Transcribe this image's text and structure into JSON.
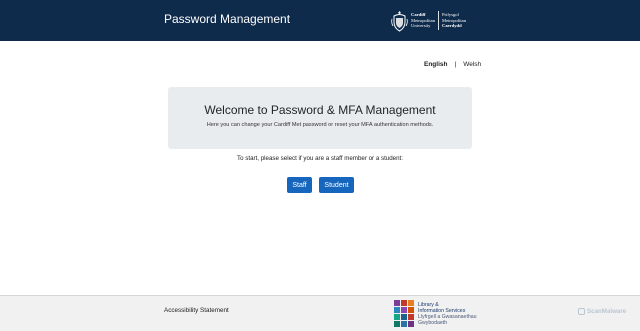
{
  "header": {
    "title": "Password Management",
    "logo": {
      "english": [
        "Cardiff",
        "Metropolitan",
        "University"
      ],
      "welsh": [
        "Prifysgol",
        "Metropolitan",
        "Caerdydd"
      ]
    }
  },
  "language": {
    "english": "English",
    "separator": "|",
    "welsh": "Welsh"
  },
  "welcome": {
    "heading": "Welcome to Password & MFA Management",
    "subtitle": "Here you can change your Cardiff Met password or reset your MFA authentication methods."
  },
  "prompt": "To start, please select if you are a staff member or a student:",
  "buttons": {
    "staff": "Staff",
    "student": "Student"
  },
  "footer": {
    "accessibility": "Accessibility Statement",
    "library_logo": {
      "line1": "Library &",
      "line2": "Information Services",
      "line3": "Llyfrgell a Gwasanaethau",
      "line4": "Gwybodaeth"
    },
    "watermark": "ScanMalware"
  },
  "colors": {
    "header_bg": "#0f2b4b",
    "button_bg": "#1766bd",
    "panel_bg": "#e9ecef",
    "footer_bg": "#f1f1f1"
  }
}
